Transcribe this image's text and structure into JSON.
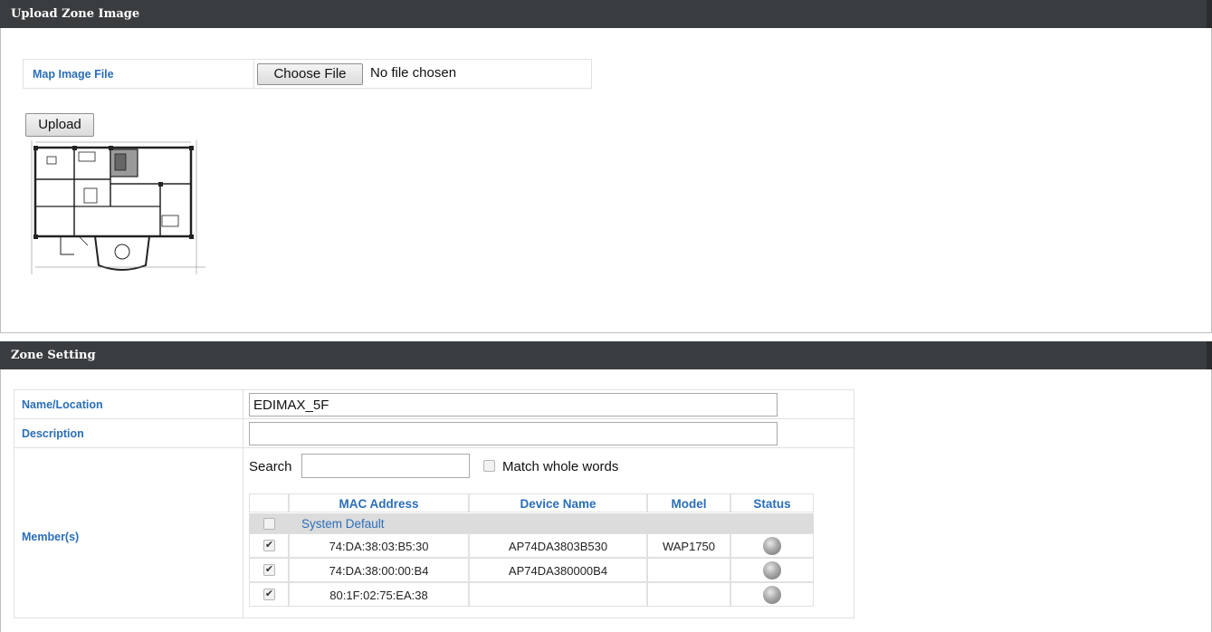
{
  "upload_panel": {
    "title": "Upload Zone Image",
    "map_file_label": "Map Image File",
    "choose_file_button": "Choose File",
    "file_status": "No file chosen",
    "upload_button": "Upload"
  },
  "zone_panel": {
    "title": "Zone Setting",
    "name_label": "Name/Location",
    "name_value": "EDIMAX_5F",
    "description_label": "Description",
    "description_value": "",
    "members_label": "Member(s)",
    "search_label": "Search",
    "search_value": "",
    "match_whole_words_label": "Match whole words",
    "match_whole_words_checked": false,
    "table": {
      "headers": [
        "MAC Address",
        "Device Name",
        "Model",
        "Status"
      ],
      "group_label": "System Default",
      "group_checked": false,
      "rows": [
        {
          "checked": true,
          "mac": "74:DA:38:03:B5:30",
          "device_name": "AP74DA3803B530",
          "model": "WAP1750",
          "status": "offline"
        },
        {
          "checked": true,
          "mac": "74:DA:38:00:00:B4",
          "device_name": "AP74DA380000B4",
          "model": "",
          "status": "offline"
        },
        {
          "checked": true,
          "mac": "80:1F:02:75:EA:38",
          "device_name": "",
          "model": "",
          "status": "offline"
        }
      ]
    }
  },
  "colors": {
    "header_bg": "#3a3d40",
    "label_blue": "#2a6eb8",
    "group_row_bg": "#dcdcdc"
  }
}
